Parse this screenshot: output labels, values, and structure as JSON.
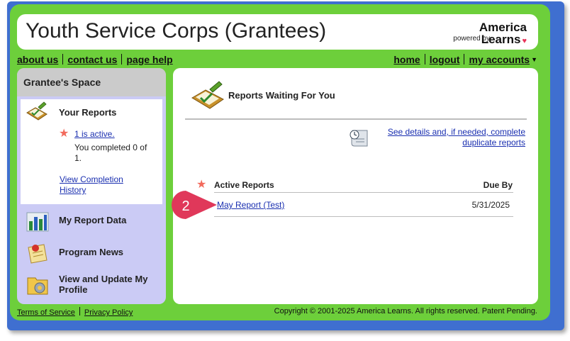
{
  "header": {
    "site_title": "Youth Service Corps (Grantees)",
    "brand_name_line1": "America",
    "brand_name_line2": "Learns",
    "brand_powered": "powered by"
  },
  "topnav": {
    "left": [
      "about us",
      "contact us",
      "page help"
    ],
    "right": [
      "home",
      "logout",
      "my accounts"
    ]
  },
  "sidebar": {
    "heading": "Grantee's Space",
    "your_reports": {
      "title": "Your Reports",
      "active_link": "1 is active.",
      "completed": "You completed 0 of 1.",
      "history_link": "View Completion History"
    },
    "items": [
      {
        "label": "My Report Data"
      },
      {
        "label": "Program News"
      },
      {
        "label": "View and Update My Profile"
      }
    ]
  },
  "main": {
    "title": "Reports Waiting For You",
    "details_link": "See details and, if needed, complete duplicate reports",
    "active_reports_header": "Active Reports",
    "due_by_header": "Due By",
    "rows": [
      {
        "name": "May Report (Test)",
        "due": "5/31/2025"
      }
    ]
  },
  "callout": {
    "number": "2"
  },
  "footer": {
    "links": [
      "Terms of Service",
      "Privacy Policy"
    ],
    "copyright": "Copyright © 2001-2025 America Learns. All rights reserved. Patent Pending."
  },
  "colors": {
    "frame_blue": "#3f6fd0",
    "outer_green": "#6dcf3b",
    "sidebar_lavender": "#cbcbf5",
    "link_blue": "#1a2fb0",
    "callout_red": "#e0385a",
    "star_salmon": "#f26a5c"
  }
}
